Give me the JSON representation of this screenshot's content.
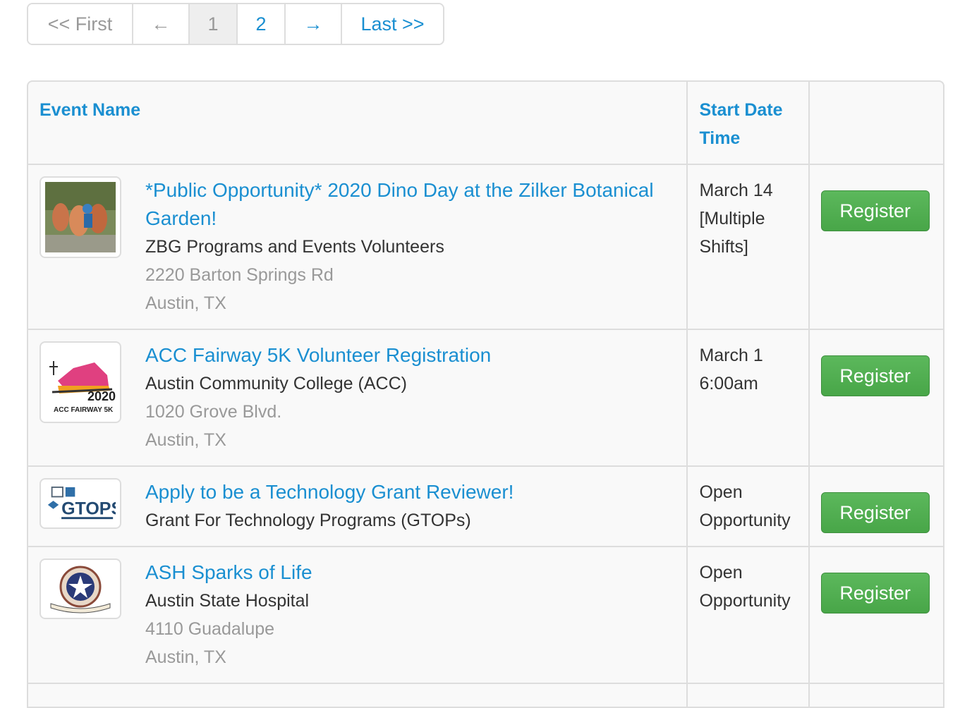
{
  "pagination": {
    "first": "<< First",
    "prev": "←",
    "pages": [
      "1",
      "2"
    ],
    "next": "→",
    "last": "Last >>",
    "current": "1"
  },
  "table": {
    "headers": {
      "event_name": "Event Name",
      "start_date": "Start Date Time",
      "actions": ""
    },
    "rows": [
      {
        "title": "*Public Opportunity* 2020 Dino Day at the Zilker Botanical Garden!",
        "org": "ZBG Programs and Events Volunteers",
        "address": "2220 Barton Springs Rd",
        "city": "Austin, TX",
        "date": "March 14 [Multiple Shifts]",
        "button": "Register",
        "thumb_icon": "dino-photo-icon"
      },
      {
        "title": "ACC Fairway 5K Volunteer Registration",
        "org": "Austin Community College (ACC)",
        "address": "1020 Grove Blvd.",
        "city": "Austin, TX",
        "date": "March 1 6:00am",
        "button": "Register",
        "thumb_icon": "acc-fairway-logo",
        "thumb_text_year": "2020",
        "thumb_text_name": "ACC FAIRWAY 5K"
      },
      {
        "title": "Apply to be a Technology Grant Reviewer!",
        "org": "Grant For Technology Programs (GTOPs)",
        "address": "",
        "city": "",
        "date": "Open Opportunity",
        "button": "Register",
        "thumb_icon": "gtops-logo",
        "thumb_text_name": "GTOPS"
      },
      {
        "title": "ASH Sparks of Life",
        "org": "Austin State Hospital",
        "address": "4110 Guadalupe",
        "city": "Austin, TX",
        "date": "Open Opportunity",
        "button": "Register",
        "thumb_icon": "ash-seal-logo"
      }
    ]
  },
  "colors": {
    "link": "#1a8fd1",
    "button": "#5cb85c",
    "muted": "#999999"
  }
}
